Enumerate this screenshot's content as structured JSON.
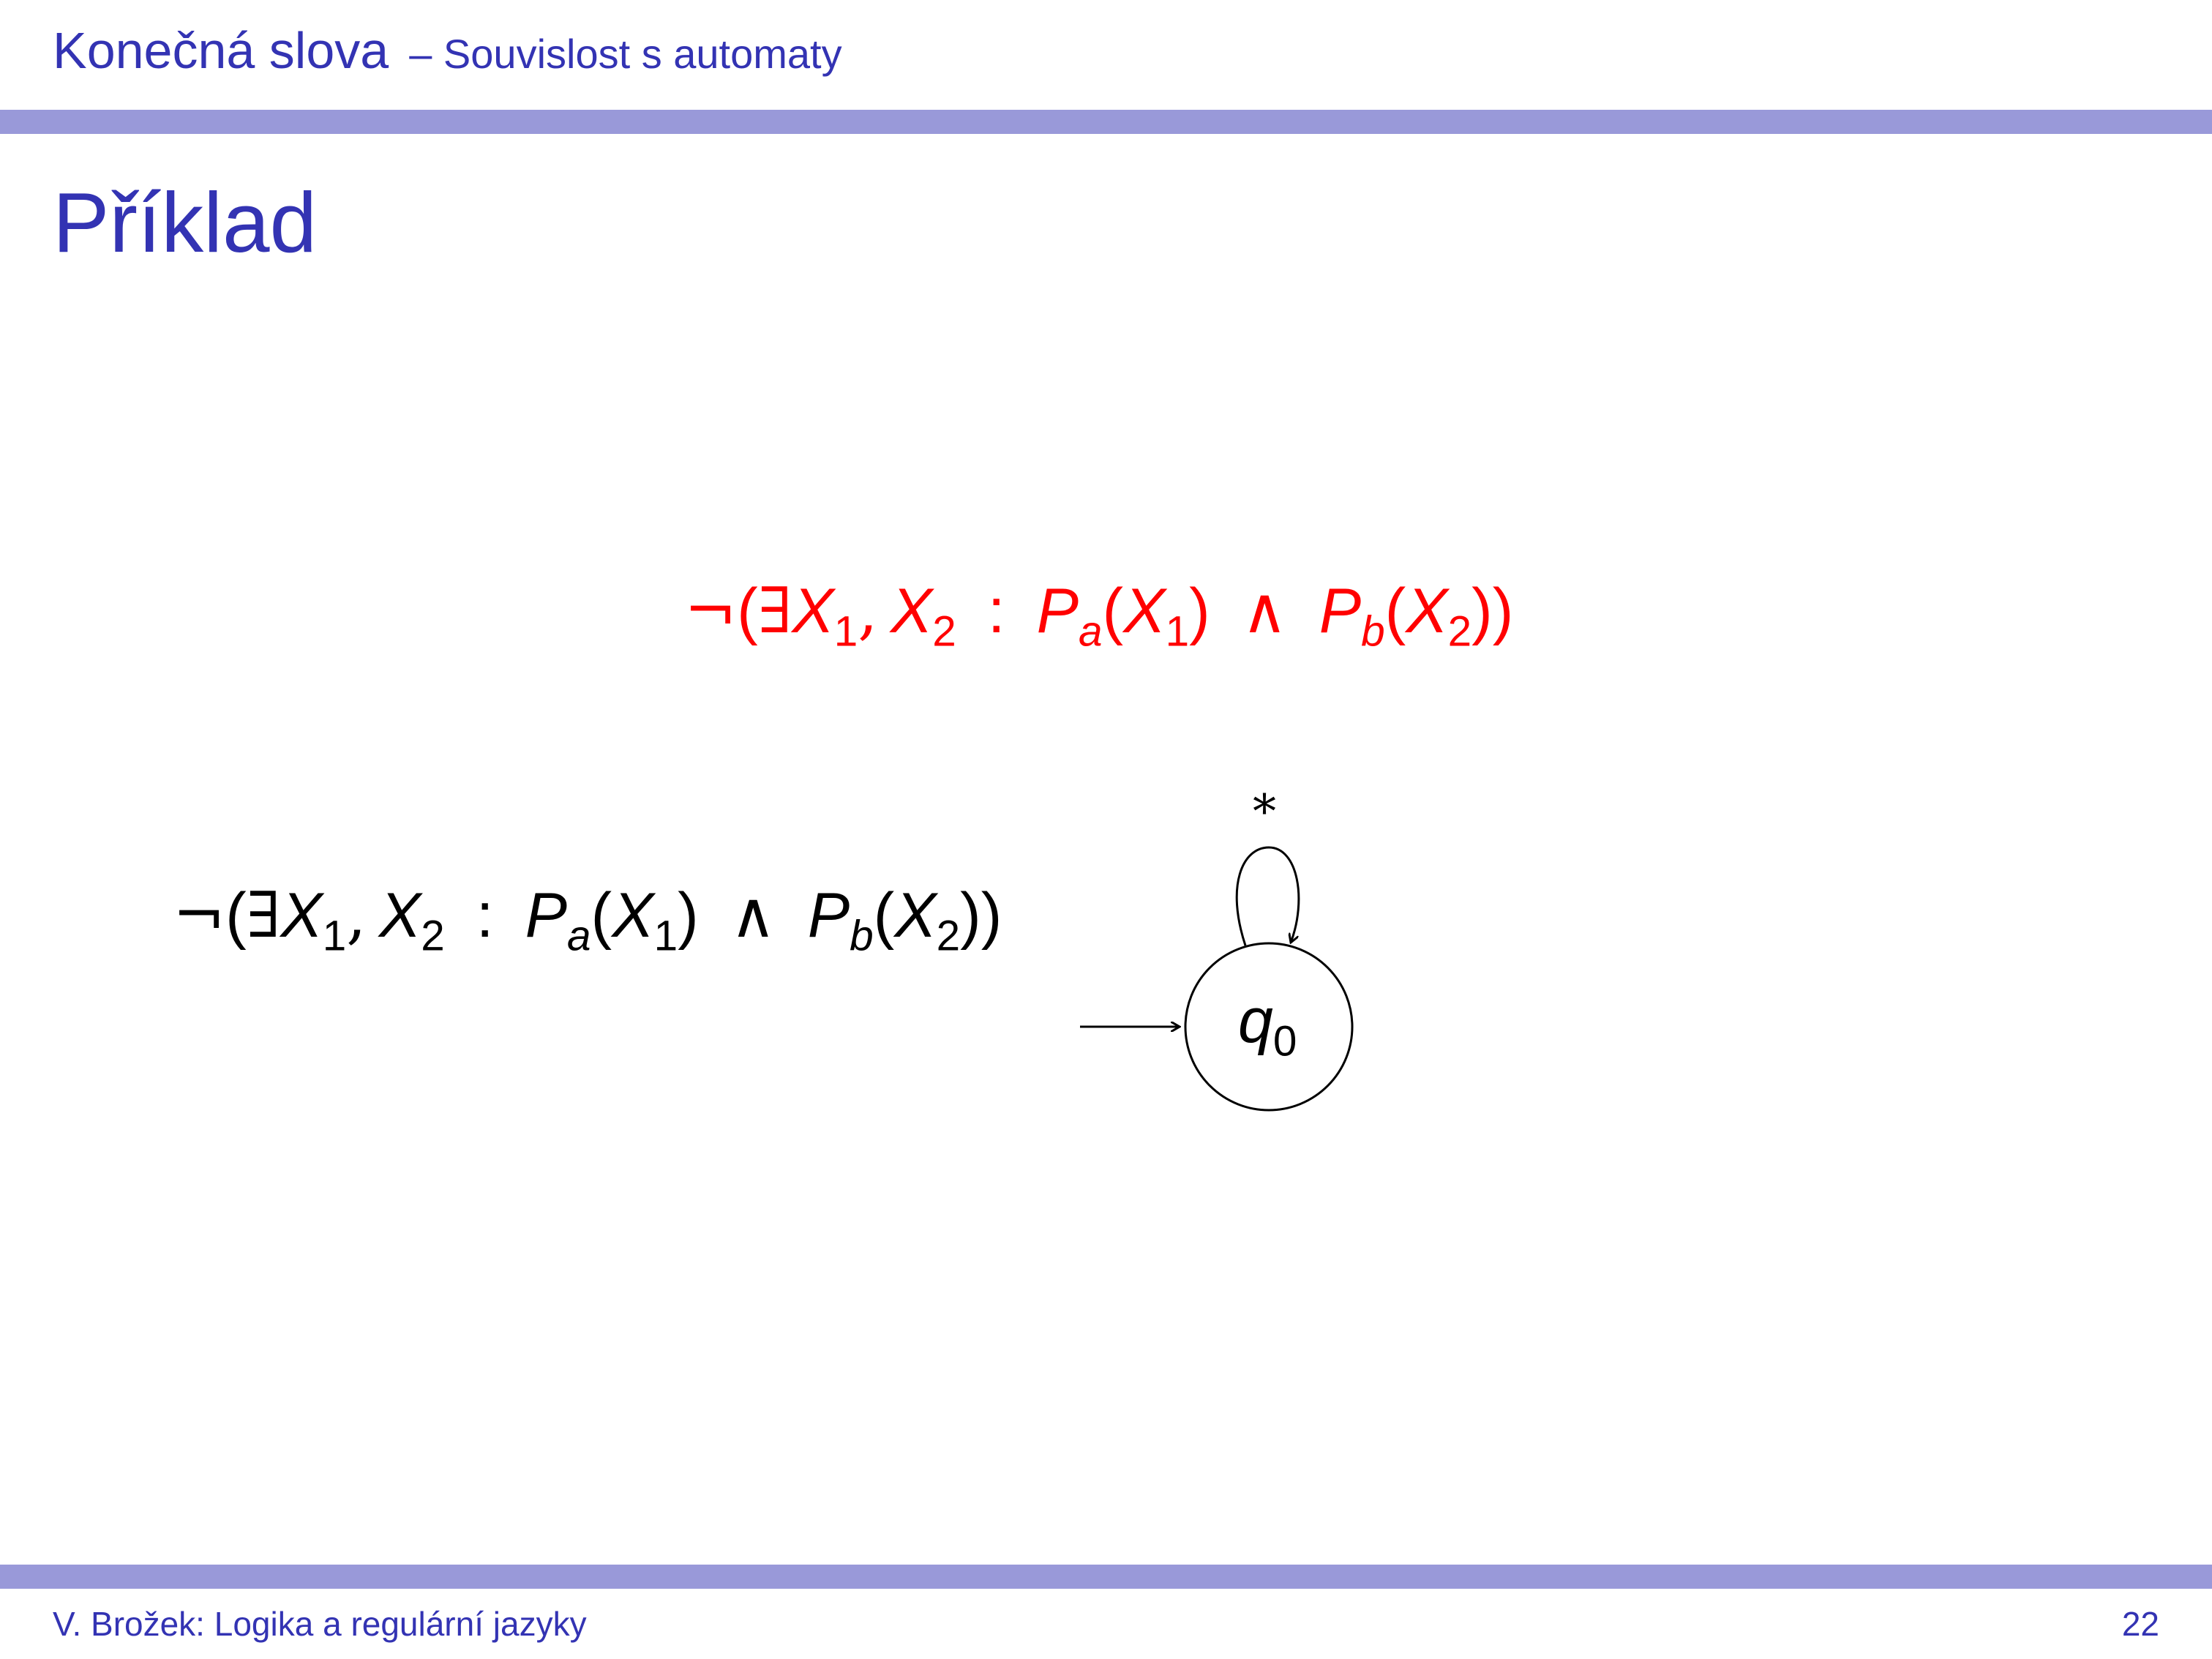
{
  "header": {
    "section": "Konečná slova",
    "subsection": "– Souvislost s automaty"
  },
  "frame": {
    "title": "Příklad"
  },
  "formula": {
    "neg": "¬",
    "open_paren": "(",
    "exists": "∃",
    "var_X": "X",
    "sub_1": "1",
    "sub_2": "2",
    "comma": ",",
    "colon": ":",
    "pred_P": "P",
    "sub_a": "a",
    "sub_b": "b",
    "and": "∧",
    "close_paren": ")",
    "double_close": "))"
  },
  "automaton": {
    "state_var": "q",
    "state_index": "0",
    "loop_label": "*"
  },
  "footer": {
    "author_title": "V. Brožek: Logika a regulární jazyky",
    "page_number": "22"
  },
  "colors": {
    "accent": "#3333b3",
    "bar": "#9999d9",
    "highlight": "#ff0000"
  }
}
